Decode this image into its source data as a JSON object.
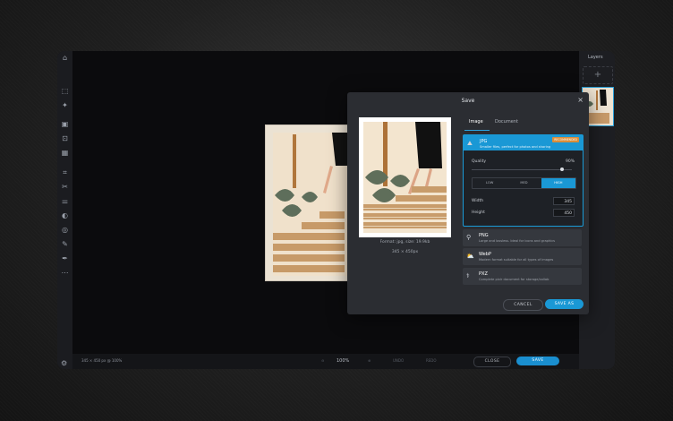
{
  "layers_panel": {
    "title": "Layers",
    "add_label": "+"
  },
  "toolbar": {
    "icons": [
      "select-icon",
      "magic-icon",
      "crop-frame-icon",
      "text-box-icon",
      "pattern-icon",
      "crop-icon",
      "cut-icon",
      "adjust-icon",
      "contrast-icon",
      "spiral-icon",
      "brush-icon",
      "pen-icon",
      "more-icon"
    ]
  },
  "status_text": "345 × 450 px @ 100%",
  "zoom": {
    "value": "100%"
  },
  "bottom": {
    "undo": "UNDO",
    "redo": "REDO",
    "close": "CLOSE",
    "save": "SAVE"
  },
  "dialog": {
    "title": "Save",
    "close_glyph": "×",
    "tabs": [
      "Image",
      "Document"
    ],
    "format_info": "Format: jpg, size: 19.9kb",
    "dimensions": "345 × 450px",
    "jpg": {
      "name": "JPG",
      "desc": "Smaller files, perfect for photos and sharing",
      "badge": "RECOMMENDED",
      "quality_label": "Quality",
      "quality_value": "90%",
      "quality_fraction": 0.9,
      "levels": [
        "LOW",
        "MED",
        "HIGH"
      ],
      "selected_level": "HIGH",
      "width_label": "Width",
      "width_value": "345",
      "height_label": "Height",
      "height_value": "450"
    },
    "png": {
      "name": "PNG",
      "desc": "Large and lossless. Ideal for icons and graphics"
    },
    "webp": {
      "name": "WebP",
      "desc": "Modern format suitable for all types of images"
    },
    "pxz": {
      "name": "PXZ",
      "desc": "Complete pixlr document for storage/collab"
    },
    "cancel_label": "CANCEL",
    "save_as_label": "SAVE AS"
  },
  "colors": {
    "accent": "#1a98d5",
    "badge": "#d98d3a"
  }
}
